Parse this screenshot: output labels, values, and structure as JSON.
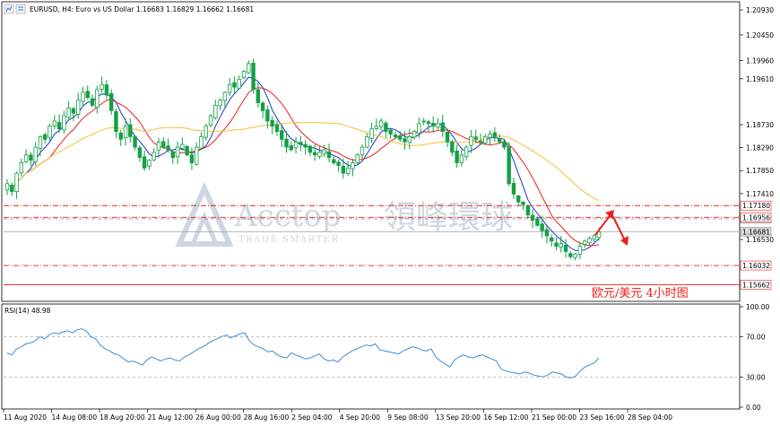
{
  "header": {
    "symbol_line": "EURUSD, H4:  Euro vs US Dollar  1.16683 1.16829 1.16662 1.16681"
  },
  "caption": "欧元/美元  4小时图",
  "watermark": {
    "brand": "Acctop",
    "brand_cn": "領峰環球",
    "tagline": "TRADE SMARTER"
  },
  "colors": {
    "bull": "#15a045",
    "bear": "#15a045",
    "ma_fast": "#e8201c",
    "ma_mid": "#1f34d0",
    "ma_slow": "#f2c230",
    "rsi": "#3b8fd8",
    "level": "#e8201c",
    "arrow": "#e8201c"
  },
  "chart_data": [
    {
      "type": "candlestick",
      "title": "EURUSD, H4: Euro vs US Dollar",
      "ohlc_last": {
        "open": 1.16683,
        "high": 1.16829,
        "low": 1.16662,
        "close": 1.16681
      },
      "ylim": [
        1.1538,
        1.2105
      ],
      "y_ticks": [
        "1.20930",
        "1.20450",
        "1.19960",
        "1.19610",
        "1.18730",
        "1.18290",
        "1.17850",
        "1.17410",
        "1.16530"
      ],
      "x_ticks": [
        "11 Aug 2020",
        "14 Aug 08:00",
        "18 Aug 20:00",
        "21 Aug 12:00",
        "26 Aug 00:00",
        "28 Aug 16:00",
        "2 Sep 04:00",
        "4 Sep 20:00",
        "9 Sep 08:00",
        "13 Sep 20:00",
        "16 Sep 12:00",
        "21 Sep 00:00",
        "23 Sep 16:00",
        "28 Sep 04:00"
      ],
      "closes": [
        1.176,
        1.1745,
        1.178,
        1.18,
        1.1815,
        1.1805,
        1.183,
        1.185,
        1.1845,
        1.187,
        1.188,
        1.1865,
        1.189,
        1.1905,
        1.1895,
        1.192,
        1.1935,
        1.1925,
        1.191,
        1.194,
        1.195,
        1.193,
        1.19,
        1.186,
        1.1845,
        1.187,
        1.185,
        1.183,
        1.181,
        1.179,
        1.1805,
        1.182,
        1.184,
        1.183,
        1.1825,
        1.181,
        1.183,
        1.1835,
        1.1815,
        1.18,
        1.183,
        1.185,
        1.187,
        1.189,
        1.191,
        1.192,
        1.1935,
        1.195,
        1.1945,
        1.196,
        1.1975,
        1.199,
        1.194,
        1.1915,
        1.19,
        1.188,
        1.187,
        1.186,
        1.1845,
        1.183,
        1.1825,
        1.184,
        1.1835,
        1.183,
        1.182,
        1.1815,
        1.182,
        1.1825,
        1.181,
        1.18,
        1.1795,
        1.178,
        1.179,
        1.18,
        1.1815,
        1.183,
        1.185,
        1.1865,
        1.187,
        1.188,
        1.186,
        1.1855,
        1.185,
        1.1845,
        1.184,
        1.185,
        1.186,
        1.1875,
        1.188,
        1.1875,
        1.187,
        1.1875,
        1.186,
        1.184,
        1.182,
        1.18,
        1.1815,
        1.183,
        1.185,
        1.1845,
        1.184,
        1.185,
        1.1855,
        1.185,
        1.184,
        1.183,
        1.176,
        1.174,
        1.1725,
        1.172,
        1.17,
        1.169,
        1.168,
        1.167,
        1.166,
        1.165,
        1.164,
        1.1645,
        1.163,
        1.162,
        1.1625,
        1.164,
        1.165,
        1.1655,
        1.166,
        1.1668
      ],
      "series": [
        {
          "name": "",
          "values": []
        }
      ],
      "levels": [
        {
          "label": "1.16928",
          "value": 1.16928,
          "style": "dash-gray"
        },
        {
          "label": "1.17180",
          "value": 1.1718,
          "style": "dashdot-red"
        },
        {
          "label": "1.16956",
          "value": 1.16956,
          "style": "dashdot-red"
        },
        {
          "label": "1.16681",
          "value": 1.16681,
          "style": "solid-gray"
        },
        {
          "label": "1.16032",
          "value": 1.16032,
          "style": "dashdot-red"
        },
        {
          "label": "1.15662",
          "value": 1.15662,
          "style": "solid-red"
        }
      ]
    },
    {
      "type": "line",
      "title": "RSI(14) 48.98",
      "ylim": [
        0,
        100
      ],
      "y_ticks": [
        "100.00",
        "70.00",
        "30.00",
        "0.00"
      ],
      "guides": [
        70,
        30
      ],
      "values": [
        54,
        52,
        58,
        60,
        63,
        64,
        66,
        70,
        68,
        72,
        74,
        73,
        75,
        76,
        74,
        77,
        78,
        76,
        70,
        68,
        62,
        58,
        56,
        53,
        52,
        48,
        45,
        46,
        44,
        42,
        47,
        50,
        48,
        46,
        48,
        49,
        47,
        46,
        50,
        52,
        55,
        58,
        60,
        63,
        66,
        68,
        70,
        72,
        69,
        71,
        73,
        74,
        66,
        62,
        60,
        58,
        55,
        56,
        52,
        50,
        49,
        54,
        52,
        50,
        48,
        49,
        51,
        53,
        48,
        46,
        47,
        45,
        50,
        53,
        56,
        58,
        60,
        62,
        61,
        63,
        57,
        56,
        55,
        54,
        53,
        56,
        58,
        60,
        59,
        57,
        56,
        58,
        50,
        46,
        43,
        40,
        47,
        50,
        52,
        50,
        49,
        51,
        52,
        50,
        48,
        46,
        38,
        36,
        35,
        34,
        33,
        35,
        34,
        32,
        31,
        30,
        32,
        35,
        34,
        33,
        30,
        29,
        31,
        36,
        40,
        42,
        44,
        49
      ]
    }
  ]
}
